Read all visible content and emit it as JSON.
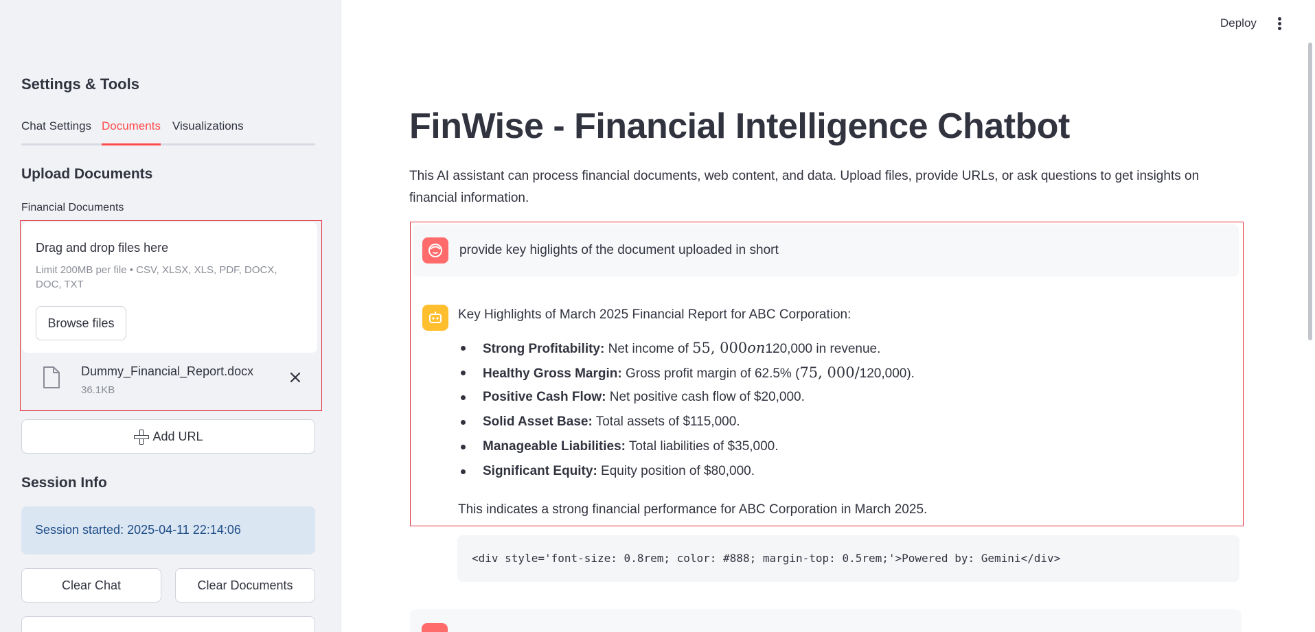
{
  "sidebar": {
    "title": "Settings & Tools",
    "tabs": [
      {
        "label": "Chat Settings",
        "active": false
      },
      {
        "label": "Documents",
        "active": true
      },
      {
        "label": "Visualizations",
        "active": false
      }
    ],
    "upload_heading": "Upload Documents",
    "field_label": "Financial Documents",
    "dropzone": {
      "title": "Drag and drop files here",
      "limit": "Limit 200MB per file • CSV, XLSX, XLS, PDF, DOCX, DOC, TXT",
      "browse_label": "Browse files"
    },
    "file": {
      "name": "Dummy_Financial_Report.docx",
      "size": "36.1KB",
      "icon": "file-icon"
    },
    "add_url_label": "Add URL",
    "session_heading": "Session Info",
    "session_text": "Session started: 2025-04-11 22:14:06",
    "clear_chat_label": "Clear Chat",
    "clear_docs_label": "Clear Documents"
  },
  "header": {
    "deploy_label": "Deploy"
  },
  "main": {
    "title": "FinWise - Financial Intelligence Chatbot",
    "description": "This AI assistant can process financial documents, web content, and data. Upload files, provide URLs, or ask questions to get insights on financial information.",
    "user_message": "provide key higlights of the document uploaded in short",
    "bot": {
      "intro": "Key Highlights of March 2025 Financial Report for ABC Corporation:",
      "bullets": [
        {
          "label": "Strong Profitability:",
          "text_a": " Net income of ",
          "math_a": "55, 000",
          "math_b": "on",
          "text_b": "120,000 in revenue."
        },
        {
          "label": "Healthy Gross Margin:",
          "text_a": " Gross profit margin of 62.5% (",
          "math_a": "75, 000/",
          "text_b": "120,000)."
        },
        {
          "label": "Positive Cash Flow:",
          "text": " Net positive cash flow of $20,000."
        },
        {
          "label": "Solid Asset Base:",
          "text": " Total assets of $115,000."
        },
        {
          "label": "Manageable Liabilities:",
          "text": " Total liabilities of $35,000."
        },
        {
          "label": "Significant Equity:",
          "text": " Equity position of $80,000."
        }
      ],
      "outro": "This indicates a strong financial performance for ABC Corporation in March 2025."
    },
    "code": "<div style='font-size: 0.8rem; color: #888; margin-top: 0.5rem;'>Powered by: Gemini</div>"
  },
  "colors": {
    "accent": "#ff4b4b",
    "highlight_border": "#e0303a",
    "user_avatar": "#ff6b6b",
    "bot_avatar": "#ffbe2e",
    "session_bg": "#dbe6f3"
  }
}
